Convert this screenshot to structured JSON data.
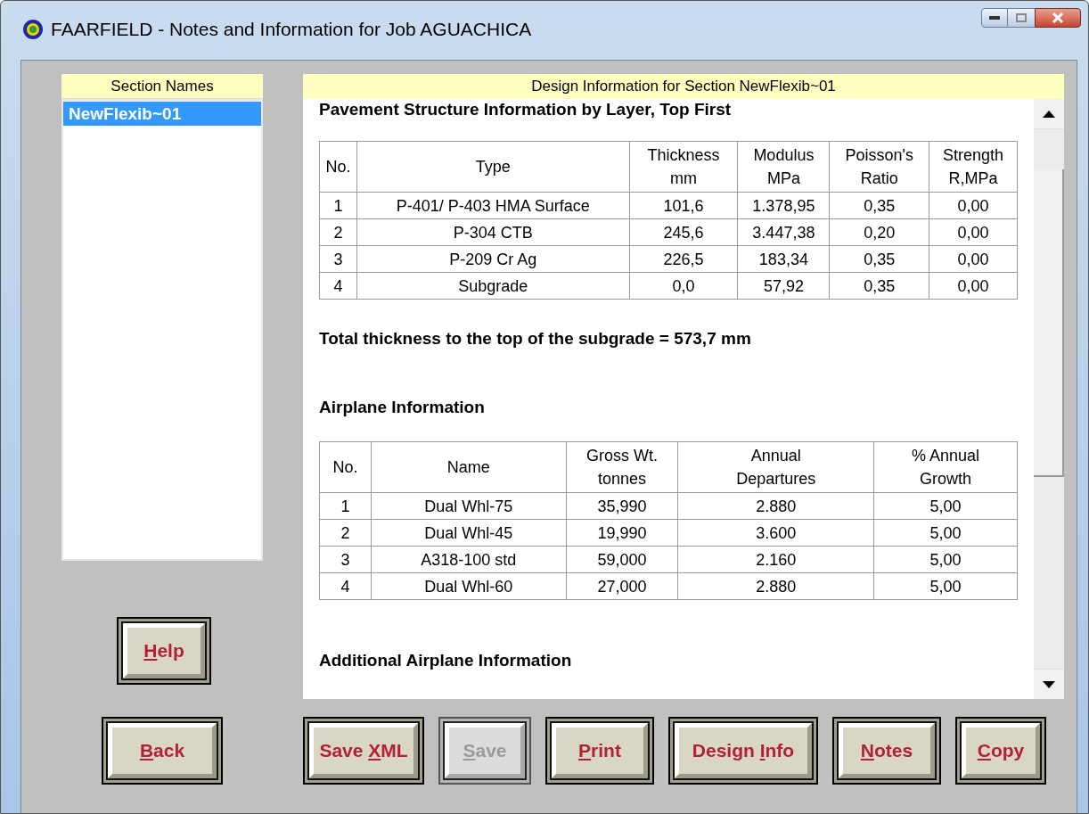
{
  "window": {
    "title": "FAARFIELD - Notes and Information for Job AGUACHICA"
  },
  "section_list": {
    "header": "Section Names",
    "items": [
      {
        "label": "NewFlexib~01",
        "selected": true
      }
    ]
  },
  "design_info": {
    "header": "Design Information for Section NewFlexib~01",
    "layers_heading": "Pavement Structure Information by Layer, Top First",
    "layers_table": {
      "columns": [
        "No.",
        "Type",
        "Thickness\nmm",
        "Modulus\nMPa",
        "Poisson's\nRatio",
        "Strength\nR,MPa"
      ],
      "rows": [
        [
          "1",
          "P-401/ P-403 HMA Surface",
          "101,6",
          "1.378,95",
          "0,35",
          "0,00"
        ],
        [
          "2",
          "P-304 CTB",
          "245,6",
          "3.447,38",
          "0,20",
          "0,00"
        ],
        [
          "3",
          "P-209 Cr Ag",
          "226,5",
          "183,34",
          "0,35",
          "0,00"
        ],
        [
          "4",
          "Subgrade",
          "0,0",
          "57,92",
          "0,35",
          "0,00"
        ]
      ]
    },
    "total_thickness": "Total thickness to the top of the subgrade = 573,7 mm",
    "airplane_heading": "Airplane Information",
    "airplane_table": {
      "columns": [
        "No.",
        "Name",
        "Gross Wt.\ntonnes",
        "Annual\nDepartures",
        "% Annual\nGrowth"
      ],
      "rows": [
        [
          "1",
          "Dual Whl-75",
          "35,990",
          "2.880",
          "5,00"
        ],
        [
          "2",
          "Dual Whl-45",
          "19,990",
          "3.600",
          "5,00"
        ],
        [
          "3",
          "A318-100 std",
          "59,000",
          "2.160",
          "5,00"
        ],
        [
          "4",
          "Dual Whl-60",
          "27,000",
          "2.880",
          "5,00"
        ]
      ]
    },
    "additional_heading": "Additional Airplane Information"
  },
  "side_buttons": [
    {
      "key": "H",
      "after": "elp",
      "disabled": false
    },
    {
      "key": "B",
      "after": "ack",
      "disabled": false
    }
  ],
  "bottom_buttons": [
    {
      "before": "Save ",
      "key": "X",
      "after": "ML",
      "disabled": false
    },
    {
      "key": "S",
      "after": "ave",
      "disabled": true
    },
    {
      "key": "P",
      "after": "rint",
      "disabled": false
    },
    {
      "before": "Design ",
      "key": "I",
      "after": "nfo",
      "disabled": false
    },
    {
      "key": "N",
      "after": "otes",
      "disabled": false
    },
    {
      "key": "C",
      "after": "opy",
      "disabled": false
    }
  ]
}
